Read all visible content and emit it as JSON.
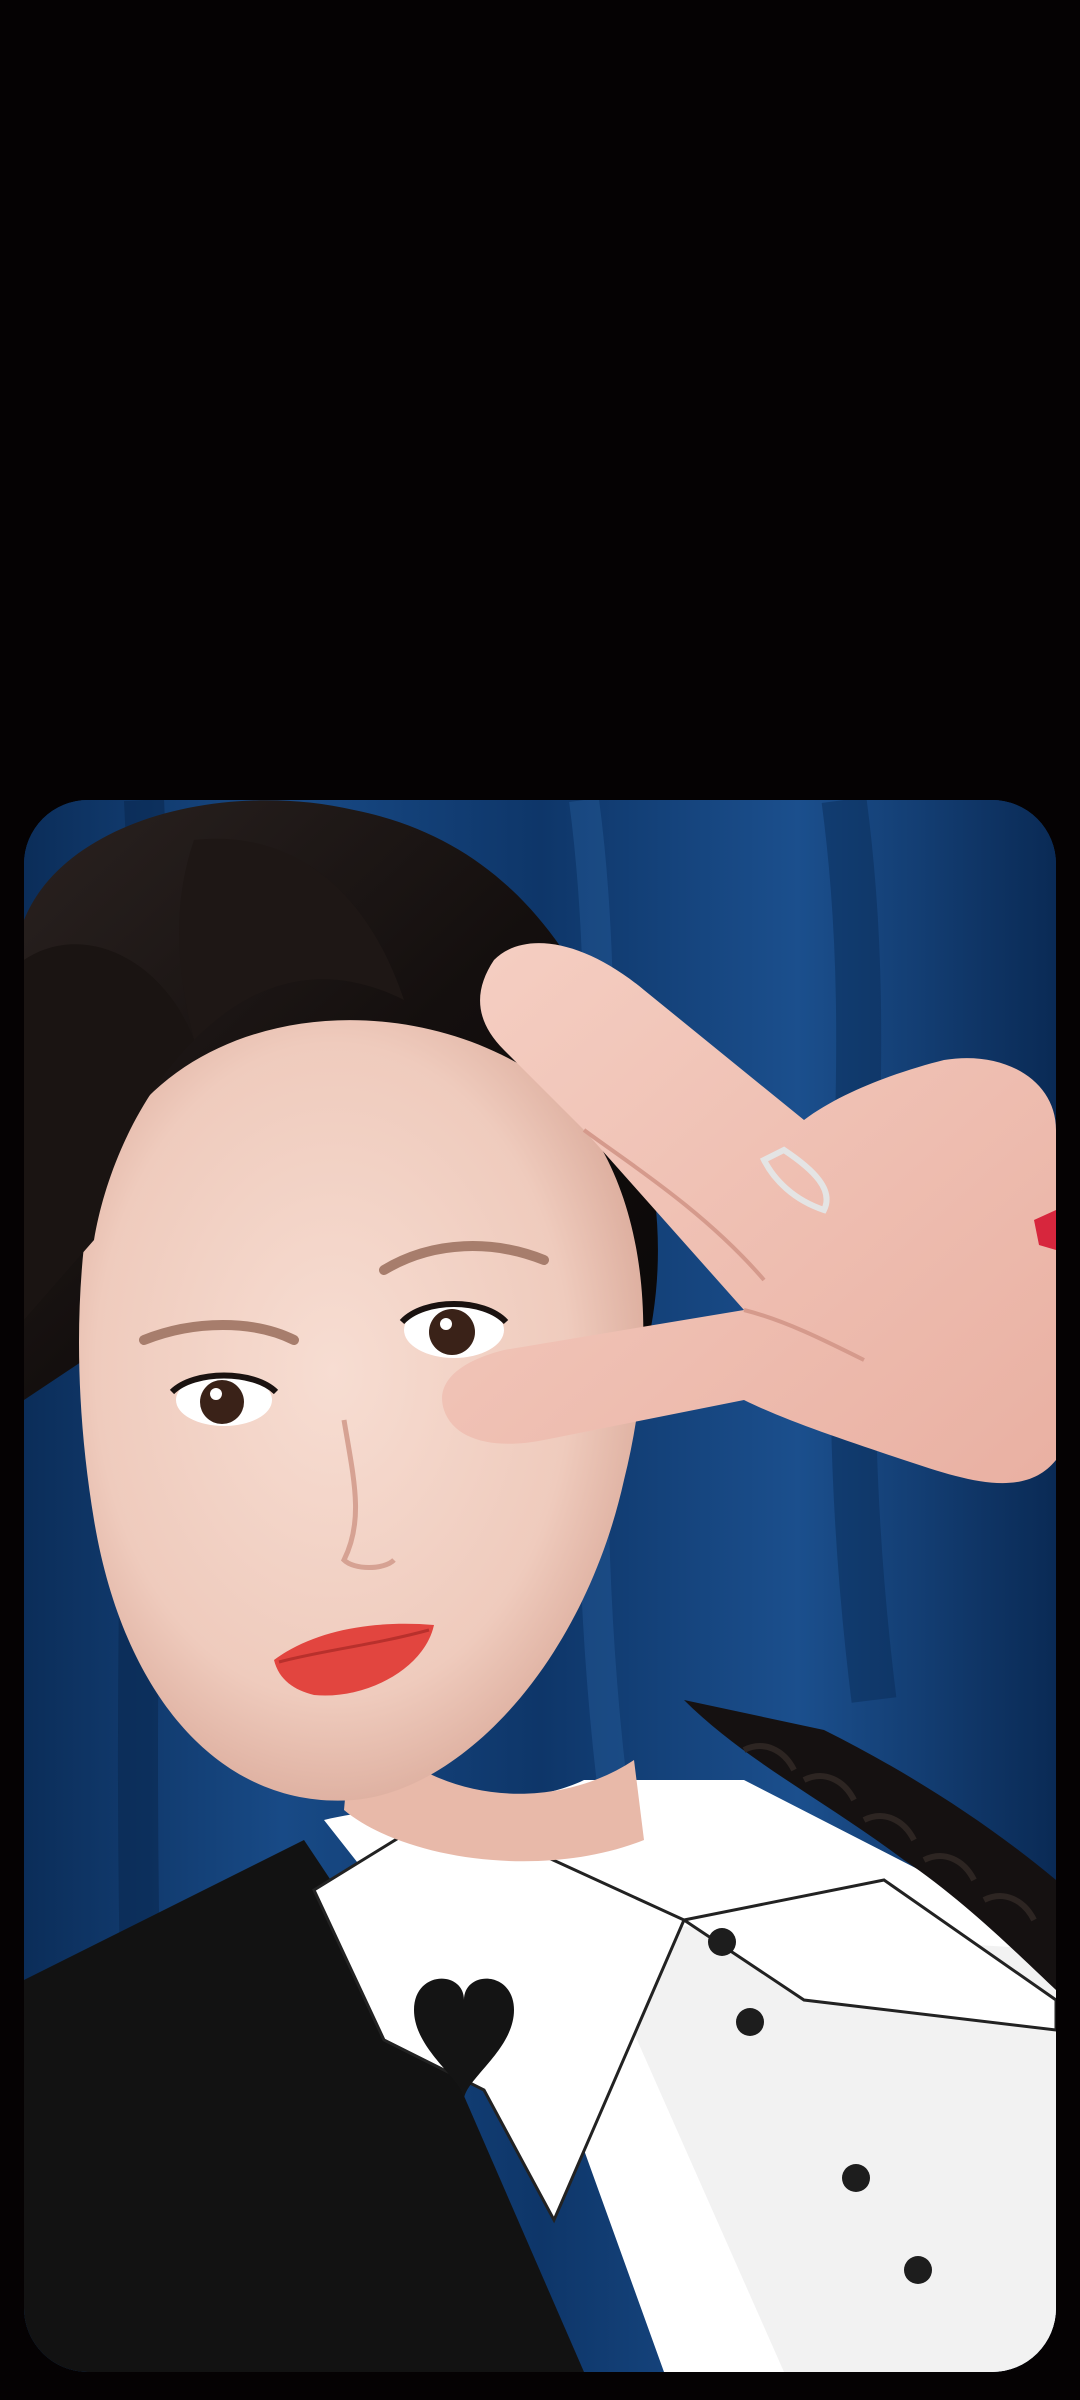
{
  "screen": {
    "background_color": "#050203"
  },
  "photo": {
    "description_icon": "photo-image",
    "colors": {
      "curtain": "#0f3a70",
      "curtain_dark": "#07264d",
      "curtain_highlight": "#2c67a6",
      "hair": "#1a1412",
      "skin": "#f2d2c6",
      "skin_shadow": "#d8aa9a",
      "lips": "#e2453f",
      "shirt": "#ffffff",
      "jacket": "#111111",
      "button": "#1d1d1d"
    }
  }
}
